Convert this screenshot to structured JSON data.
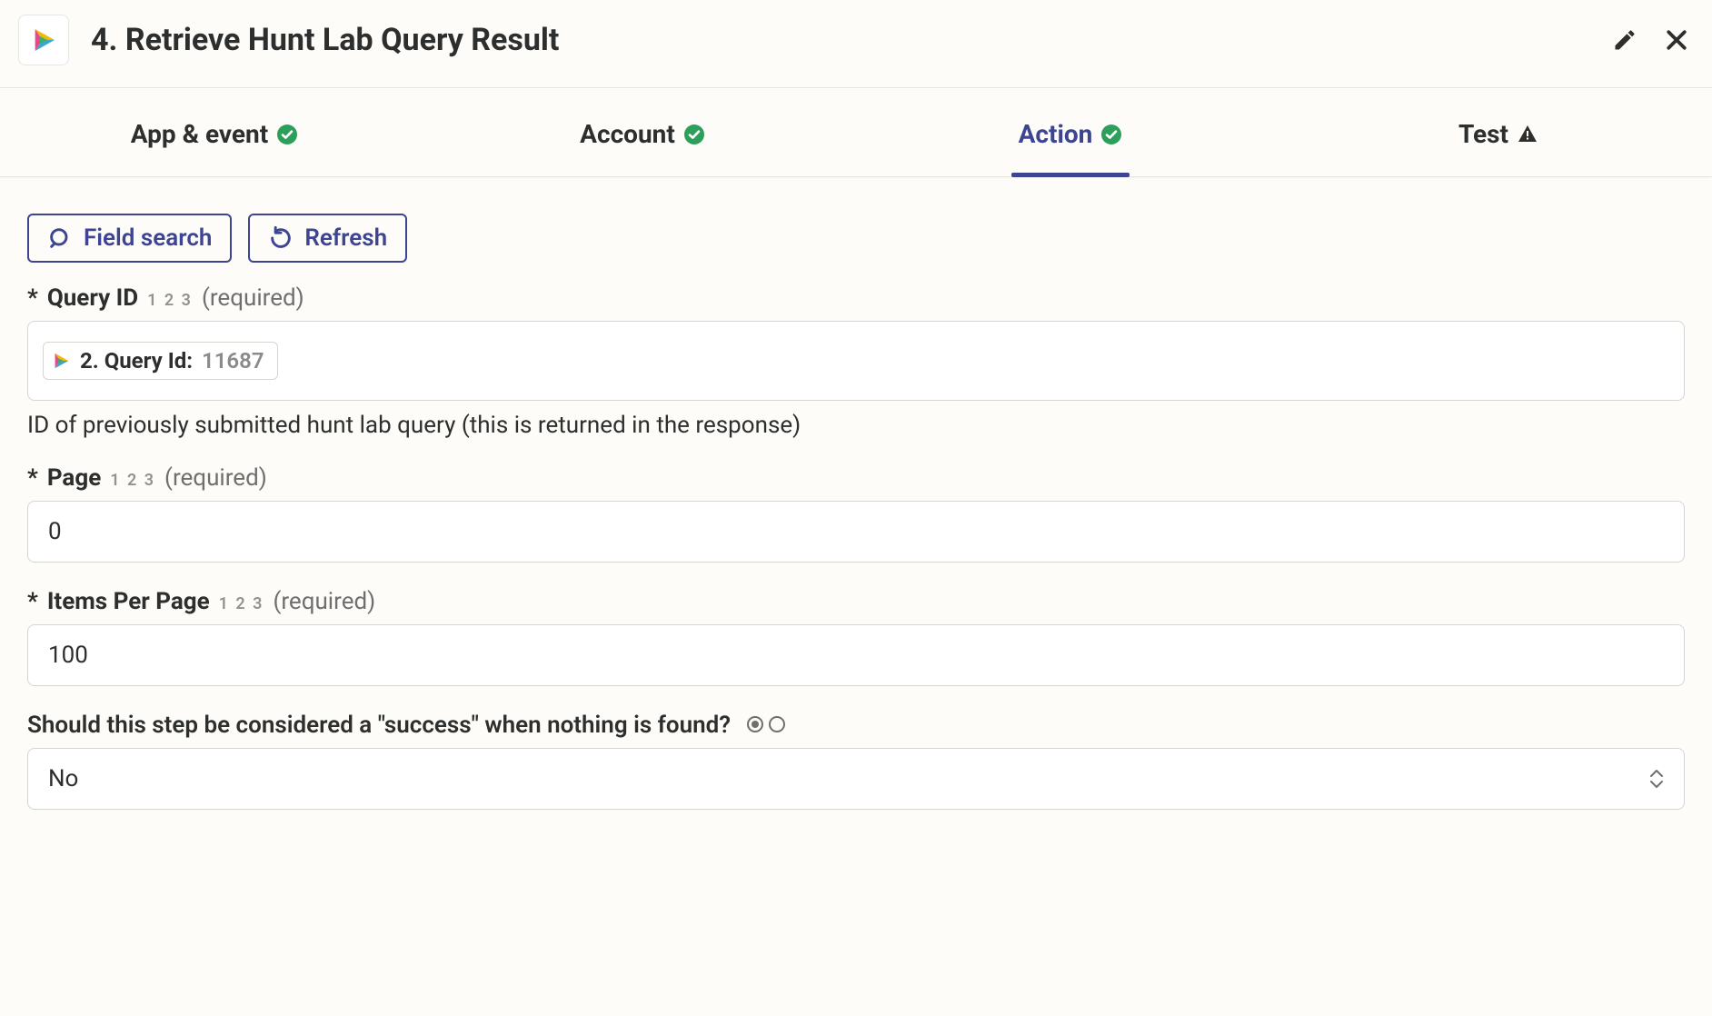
{
  "header": {
    "title": "4. Retrieve Hunt Lab Query Result"
  },
  "tabs": {
    "app_event": "App & event",
    "account": "Account",
    "action": "Action",
    "test": "Test"
  },
  "toolbar": {
    "field_search": "Field search",
    "refresh": "Refresh"
  },
  "fields": {
    "query_id": {
      "label": "Query ID",
      "type_hint": "1 2 3",
      "required": "(required)",
      "pill_label": "2. Query Id:",
      "pill_value": "11687",
      "help": "ID of previously submitted hunt lab query (this is returned in the response)"
    },
    "page": {
      "label": "Page",
      "type_hint": "1 2 3",
      "required": "(required)",
      "value": "0"
    },
    "items_per_page": {
      "label": "Items Per Page",
      "type_hint": "1 2 3",
      "required": "(required)",
      "value": "100"
    },
    "success_when_empty": {
      "label": "Should this step be considered a \"success\" when nothing is found?",
      "value": "No"
    }
  }
}
